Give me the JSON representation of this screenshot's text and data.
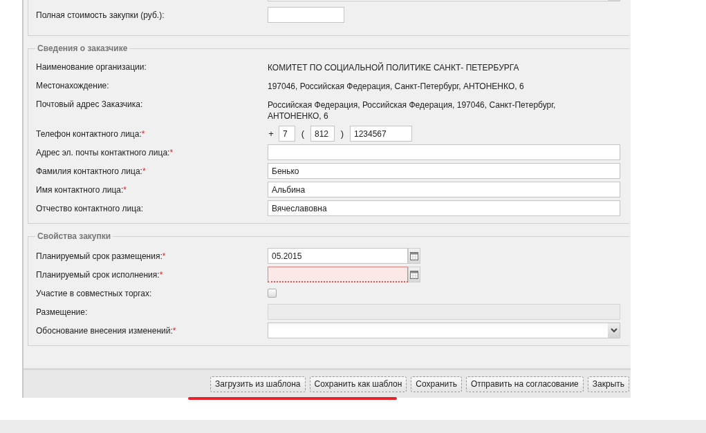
{
  "sections": [
    {
      "clipped_top": true,
      "rows": [
        {
          "kind": "select"
        },
        {
          "kind": "input",
          "label": "Полная стоимость закупки (руб.):",
          "value": "",
          "short": true
        }
      ]
    },
    {
      "legend": "Сведения о заказчике",
      "clipped_top": false,
      "rows": [
        {
          "kind": "text",
          "label": "Наименование организации:",
          "value": "КОМИТЕТ ПО СОЦИАЛЬНОЙ ПОЛИТИКЕ САНКТ- ПЕТЕРБУРГА"
        },
        {
          "kind": "text",
          "label": "Местонахождение:",
          "value": "197046, Российская Федерация, Санкт-Петербург, АНТОНЕНКО, 6"
        },
        {
          "kind": "text",
          "label": "Почтовый адрес Заказчика:",
          "value": "Российская Федерация, Российская Федерация, 197046, Санкт-Петербург, АНТОНЕНКО, 6"
        },
        {
          "kind": "phone",
          "label": "Телефон контактного лица:",
          "required_mark": "*",
          "plus": "+",
          "country": "7",
          "open": "(",
          "area": "812",
          "close": ")",
          "number": "1234567"
        },
        {
          "kind": "input",
          "label": "Адрес эл. почты контактного лица:",
          "required_mark": "*",
          "value": ""
        },
        {
          "kind": "input",
          "label": "Фамилия контактного лица:",
          "required_mark": "*",
          "value": "Бенько"
        },
        {
          "kind": "input",
          "label": "Имя контактного лица:",
          "required_mark": "*",
          "value": "Альбина"
        },
        {
          "kind": "input",
          "label": "Отчество контактного лица:",
          "value": "Вячеславовна"
        }
      ]
    },
    {
      "legend": "Свойства закупки",
      "clipped_top": false,
      "rows": [
        {
          "kind": "date",
          "label": "Планируемый срок размещения:",
          "required_mark": "*",
          "value": "05.2015",
          "invalid": false
        },
        {
          "kind": "date",
          "label": "Планируемый срок исполнения:",
          "required_mark": "*",
          "value": "",
          "invalid": true
        },
        {
          "kind": "checkbox",
          "label": "Участие в совместных торгах:",
          "checked": false
        },
        {
          "kind": "input",
          "label": "Размещение:",
          "value": "",
          "disabled": true
        },
        {
          "kind": "select",
          "label": "Обоснование внесения изменений:",
          "required_mark": "*"
        }
      ]
    }
  ],
  "buttons": [
    {
      "label": "Загрузить из шаблона",
      "underlined": true
    },
    {
      "label": "Сохранить как шаблон",
      "underlined": true
    },
    {
      "label": "Сохранить",
      "underlined": false
    },
    {
      "label": "Отправить на согласование",
      "underlined": false
    },
    {
      "label": "Закрыть",
      "underlined": false
    }
  ]
}
